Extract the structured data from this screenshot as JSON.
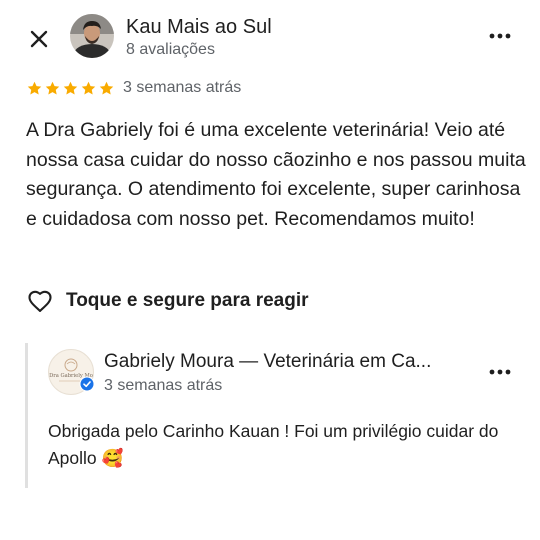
{
  "review": {
    "author_name": "Kau Mais ao Sul",
    "author_subtitle": "8 avaliações",
    "rating": 5,
    "date": "3 semanas atrás",
    "text": "A Dra Gabriely foi é uma excelente veterinária! Veio até nossa casa cuidar do nosso cãozinho e nos passou muita segurança. O atendimento foi excelente, super carinhosa e cuidadosa com nosso pet. Recomendamos muito!",
    "react_label": "Toque e segure para reagir"
  },
  "reply": {
    "owner_name": "Gabriely Moura — Veterinária em Ca...",
    "date": "3 semanas atrás",
    "text": "Obrigada pelo Carinho Kauan ! Foi um privilégio cuidar do Apollo 🥰",
    "logo_text": "Dra Gabriely Mo"
  },
  "icons": {
    "close": "close-icon",
    "more": "more-vert-icon",
    "star": "star-icon",
    "heart": "heart-outline-icon",
    "verified": "verified-badge-icon"
  },
  "colors": {
    "star": "#f9ab00",
    "verified": "#1a73e8",
    "secondary_text": "#5f6368",
    "reply_bar": "#e0e0e0"
  }
}
